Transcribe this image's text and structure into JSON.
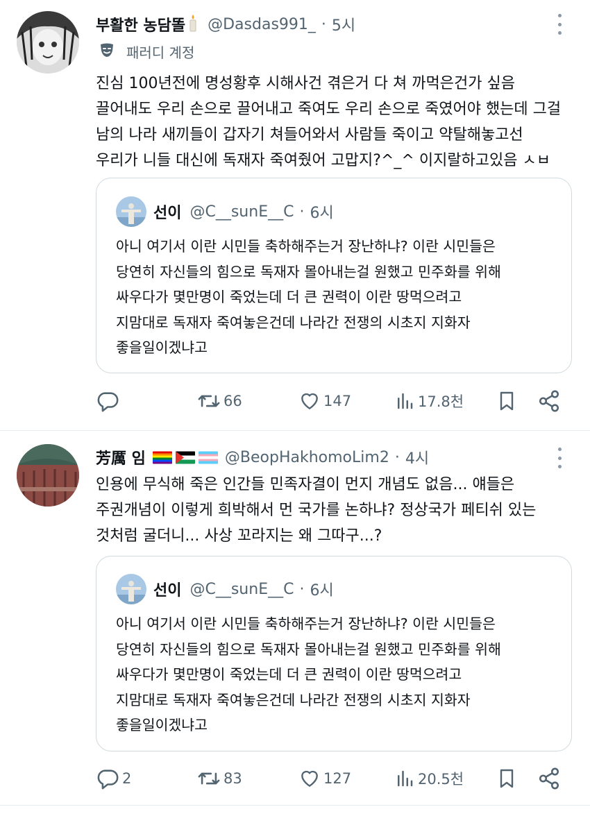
{
  "tweets": [
    {
      "display_name": "부활한 농담똘",
      "handle": "@Dasdas991_",
      "dot": "·",
      "time": "5시",
      "label": "패러디 계정",
      "text": "진심 100년전에 명성황후 시해사건 겪은거 다 쳐 까먹은건가 싶음\n끌어내도 우리 손으로 끌어내고 죽여도 우리 손으로 죽였어야 했는데 그걸\n남의 나라 새끼들이 갑자기 쳐들어와서 사람들 죽이고 약탈해놓고선\n우리가 니들 대신에 독재자 죽여줬어 고맙지?^_^ 이지랄하고있음 ㅅㅂ",
      "quote": {
        "display_name": "선이",
        "handle": "@C__sunE__C",
        "dot": "·",
        "time": "6시",
        "text": "아니 여기서 이란 시민들 축하해주는거 장난하냐? 이란 시민들은\n당연히 자신들의 힘으로 독재자 몰아내는걸 원했고 민주화를 위해\n싸우다가 몇만명이 죽었는데 더 큰 권력이 이란 땅먹으려고\n지맘대로 독재자 죽여놓은건데 나라간 전쟁의 시초지 지화자\n좋을일이겠냐고"
      },
      "actions": {
        "replies": "",
        "retweets": "66",
        "likes": "147",
        "views": "17.8천"
      }
    },
    {
      "display_name": "芳厲 임",
      "flags": [
        "rainbow-flag",
        "palestine-flag",
        "transgender-flag"
      ],
      "handle": "@BeopHakhomoLim2",
      "dot": "·",
      "time": "4시",
      "text": "인용에 무식해 죽은 인간들 민족자결이 먼지 개념도 없음... 얘들은\n주권개념이 이렇게 희박해서 먼 국가를 논하냐? 정상국가 페티쉬 있는\n것처럼 굴더니... 사상 꼬라지는 왜 그따구...?",
      "quote": {
        "display_name": "선이",
        "handle": "@C__sunE__C",
        "dot": "·",
        "time": "6시",
        "text": "아니 여기서 이란 시민들 축하해주는거 장난하냐? 이란 시민들은\n당연히 자신들의 힘으로 독재자 몰아내는걸 원했고 민주화를 위해\n싸우다가 몇만명이 죽었는데 더 큰 권력이 이란 땅먹으려고\n지맘대로 독재자 죽여놓은건데 나라간 전쟁의 시초지 지화자\n좋을일이겠냐고"
      },
      "actions": {
        "replies": "2",
        "retweets": "83",
        "likes": "127",
        "views": "20.5천"
      }
    }
  ],
  "colors": {
    "text": "#0f1419",
    "secondary": "#536471",
    "border": "#cfd9de",
    "divider": "#e7ecf0"
  },
  "icons": [
    "reply-icon",
    "retweet-icon",
    "like-icon",
    "views-icon",
    "bookmark-icon",
    "share-icon",
    "more-icon",
    "parody-mask-icon",
    "candle-icon"
  ]
}
